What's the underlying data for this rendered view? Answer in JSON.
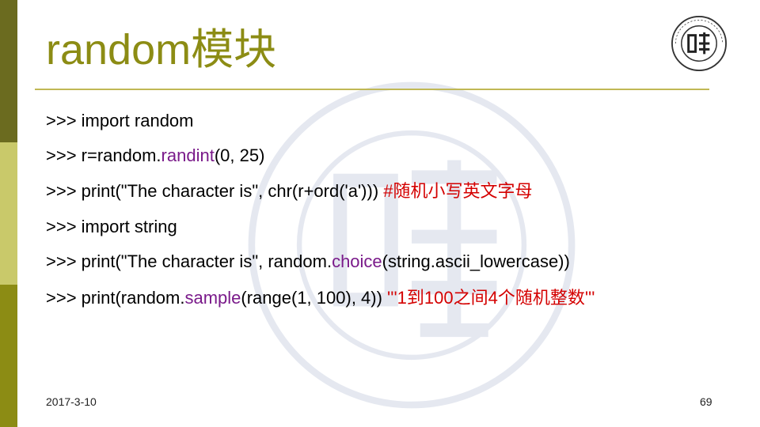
{
  "slide": {
    "title": "random模块",
    "code_lines": [
      {
        "a": ">>> import random"
      },
      {
        "a": ">>> r=random.",
        "fn": "randint",
        "b": "(0, 25)"
      },
      {
        "a": ">>> print(\"The character is\", chr(r+ord('a'))) ",
        "comment": "#随机小写英文字母"
      },
      {
        "a": ">>> import string"
      },
      {
        "a": ">>> print(\"The character is\", random.",
        "fn": "choice",
        "b": "(string.ascii_lowercase))"
      },
      {
        "a": ">>> print(random.",
        "fn": "sample",
        "b": "(range(1, 100),  4))  ",
        "comment": "'''1到100之间4个随机整数'''"
      }
    ],
    "date": "2017-3-10",
    "page_number": "69"
  },
  "colors": {
    "title": "#8c8c14",
    "function": "#7a1a8a",
    "comment": "#d40000",
    "bar_top": "#6b6b1f",
    "bar_middle": "#c9c96a",
    "bar_bottom": "#8c8c14"
  },
  "icons": {
    "logo": "fudan-university-seal-icon",
    "watermark": "fudan-university-seal-watermark-icon"
  }
}
